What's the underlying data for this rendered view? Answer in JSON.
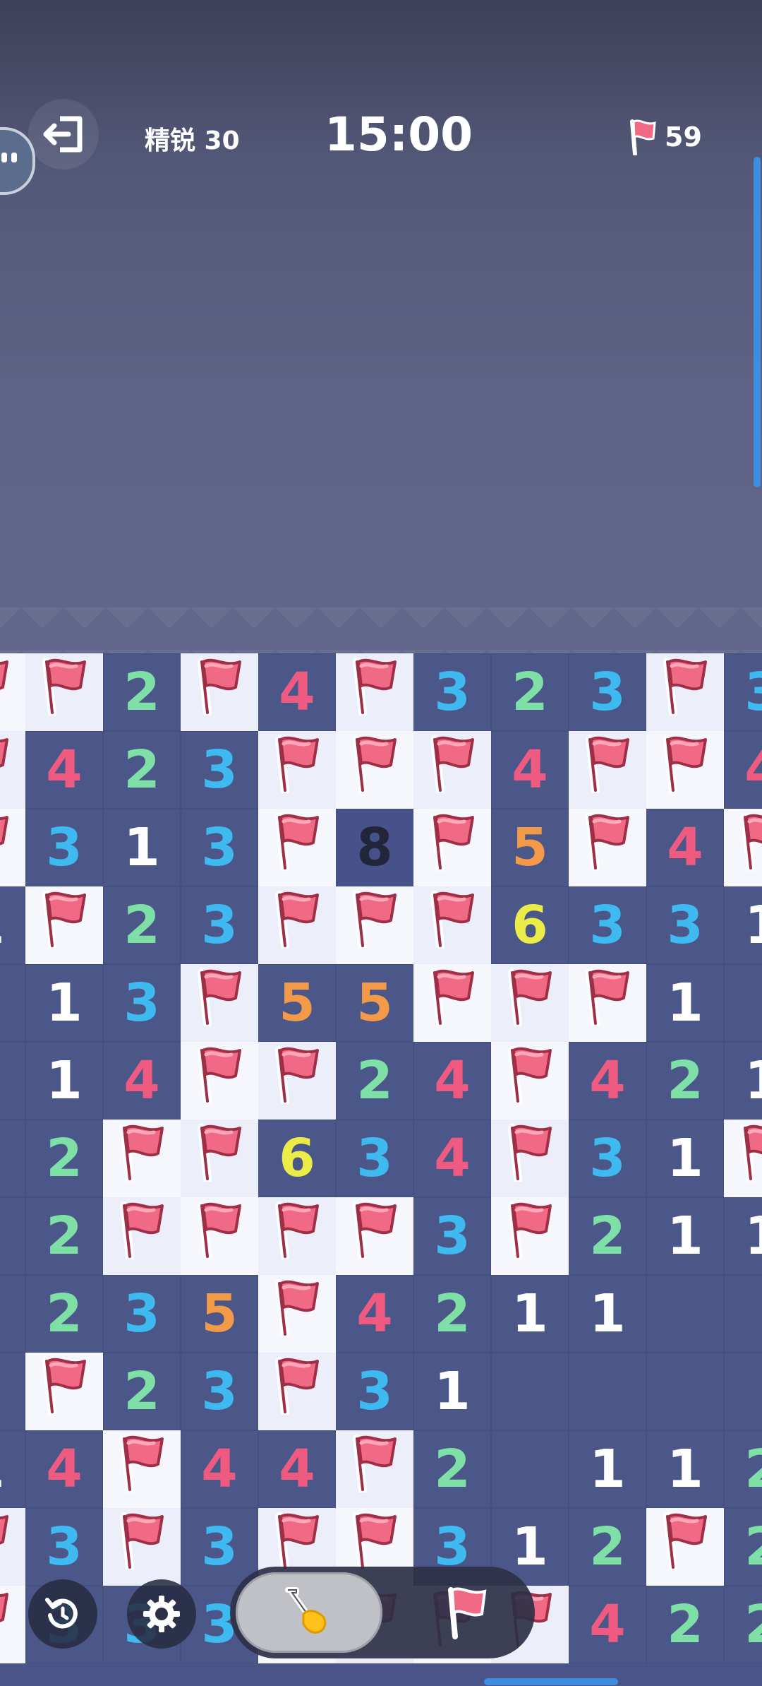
{
  "hud": {
    "level_label": "精锐 30",
    "timer": "15:00",
    "flags_remaining": "59"
  },
  "colors": {
    "flag": "#f06a86",
    "n1": "#ffffff",
    "n2": "#7ee0a6",
    "n3": "#3fbaf0",
    "n4": "#ee5a80",
    "n5": "#f39a48",
    "n6": "#ecec48",
    "n8": "#23263a"
  },
  "icons": {
    "exit": "exit-icon",
    "restart": "restart-icon",
    "settings": "gear-icon",
    "dig": "shovel-icon",
    "flag": "flag-icon"
  },
  "board": {
    "rows": [
      [
        "F",
        "F",
        "2",
        "F",
        "4",
        "F",
        "3",
        "2",
        "3",
        "F",
        "3"
      ],
      [
        "F",
        "4",
        "2",
        "3",
        "F",
        "F",
        "F",
        "4",
        "F",
        "F",
        "4"
      ],
      [
        "F",
        "3",
        "1",
        "3",
        "F",
        "8",
        "F",
        "5",
        "F",
        "4",
        "F"
      ],
      [
        "1",
        "F",
        "2",
        "3",
        "F",
        "F",
        "F",
        "6",
        "3",
        "3",
        "1"
      ],
      [
        "",
        "1",
        "3",
        "F",
        "5",
        "5",
        "F",
        "F",
        "F",
        "1",
        ""
      ],
      [
        "",
        "1",
        "4",
        "F",
        "F",
        "2",
        "4",
        "F",
        "4",
        "2",
        "1"
      ],
      [
        "",
        "2",
        "F",
        "F",
        "6",
        "3",
        "4",
        "F",
        "3",
        "1",
        "F"
      ],
      [
        "",
        "2",
        "F",
        "F",
        "F",
        "F",
        "3",
        "F",
        "2",
        "1",
        "1"
      ],
      [
        "",
        "2",
        "3",
        "5",
        "F",
        "4",
        "2",
        "1",
        "1",
        "",
        ""
      ],
      [
        "",
        "F",
        "2",
        "3",
        "F",
        "3",
        "1",
        "",
        "",
        "",
        ""
      ],
      [
        "1",
        "4",
        "F",
        "4",
        "4",
        "F",
        "2",
        "",
        "1",
        "1",
        "2"
      ],
      [
        "F",
        "3",
        "F",
        "3",
        "F",
        "F",
        "3",
        "1",
        "2",
        "F",
        "2"
      ],
      [
        "F",
        "3",
        "3",
        "3",
        "F",
        "F",
        "F",
        "F",
        "4",
        "2",
        "2"
      ]
    ]
  }
}
